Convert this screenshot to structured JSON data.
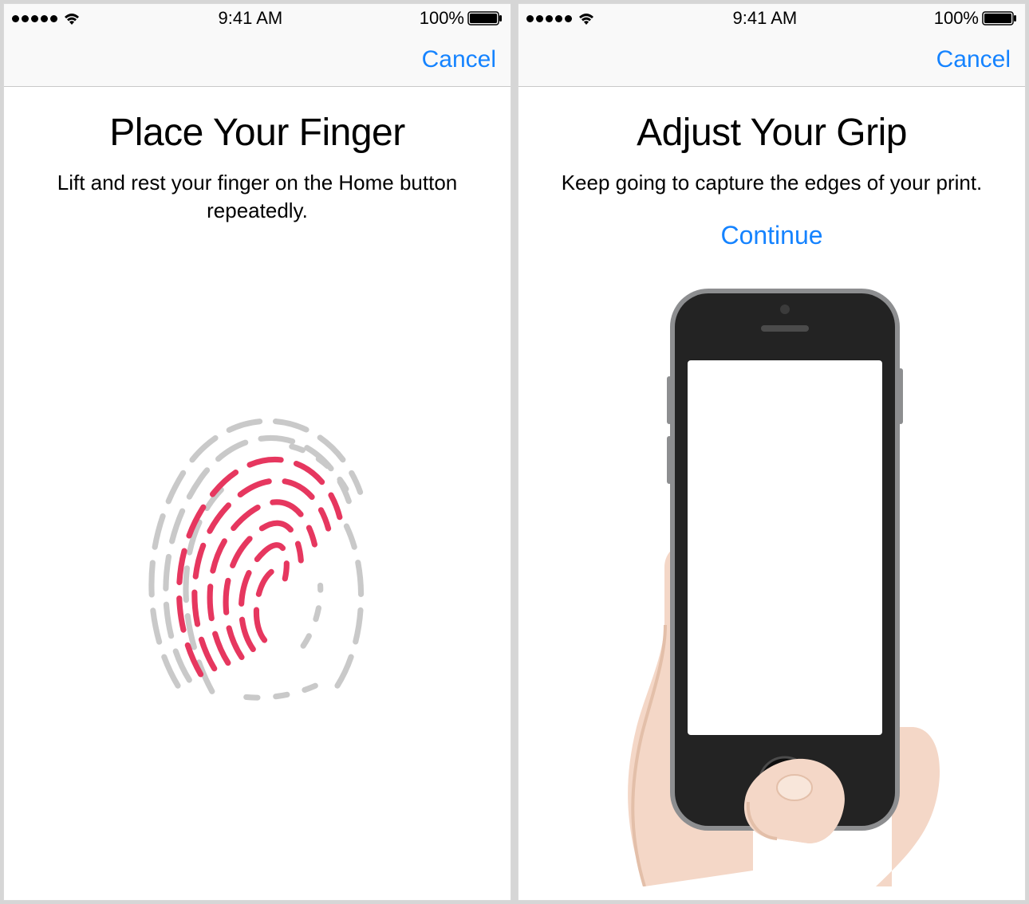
{
  "colors": {
    "accent": "#1583ff",
    "fingerprint_active": "#e6375f",
    "fingerprint_inactive": "#c9c9c9",
    "phone_dark": "#232323",
    "phone_silver": "#8d8e90",
    "skin": "#f4d7c7",
    "skin_shadow": "#e3bfa9"
  },
  "status_bar": {
    "time": "9:41 AM",
    "battery_pct": "100%"
  },
  "left_screen": {
    "cancel_label": "Cancel",
    "title": "Place Your Finger",
    "subtitle": "Lift and rest your finger on the Home button repeatedly."
  },
  "right_screen": {
    "cancel_label": "Cancel",
    "title": "Adjust Your Grip",
    "subtitle": "Keep going to capture the edges of your print.",
    "continue_label": "Continue"
  }
}
